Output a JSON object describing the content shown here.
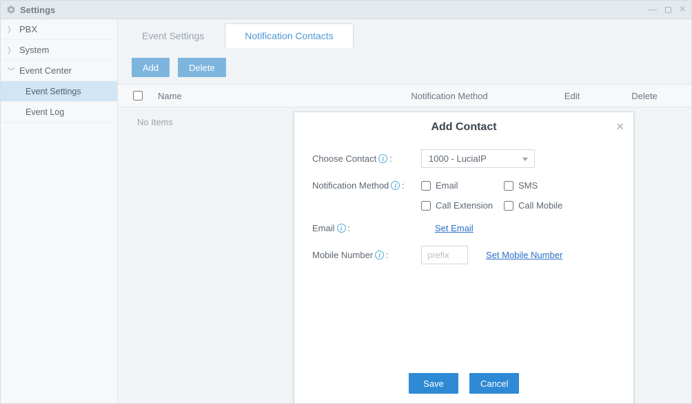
{
  "window": {
    "title": "Settings"
  },
  "sidebar": {
    "items": [
      {
        "label": "PBX",
        "type": "group",
        "expanded": false
      },
      {
        "label": "System",
        "type": "group",
        "expanded": false
      },
      {
        "label": "Event Center",
        "type": "group",
        "expanded": true
      },
      {
        "label": "Event Settings",
        "type": "sub",
        "active": true
      },
      {
        "label": "Event Log",
        "type": "sub",
        "active": false
      }
    ]
  },
  "tabs": [
    "Event Settings",
    "Notification Contacts"
  ],
  "active_tab": 1,
  "toolbar": {
    "add": "Add",
    "delete": "Delete"
  },
  "table": {
    "columns": {
      "name": "Name",
      "method": "Notification Method",
      "edit": "Edit",
      "delete": "Delete"
    },
    "empty": "No Items"
  },
  "modal": {
    "title": "Add Contact",
    "fields": {
      "choose_contact": {
        "label": "Choose Contact",
        "value": "1000 - LuciaIP"
      },
      "notification_method": {
        "label": "Notification Method",
        "options": {
          "email": "Email",
          "sms": "SMS",
          "call_ext": "Call Extension",
          "call_mobile": "Call Mobile"
        }
      },
      "email": {
        "label": "Email",
        "link": "Set Email"
      },
      "mobile": {
        "label": "Mobile Number",
        "prefix_placeholder": "prefix",
        "link": "Set Mobile Number"
      }
    },
    "buttons": {
      "save": "Save",
      "cancel": "Cancel"
    }
  }
}
